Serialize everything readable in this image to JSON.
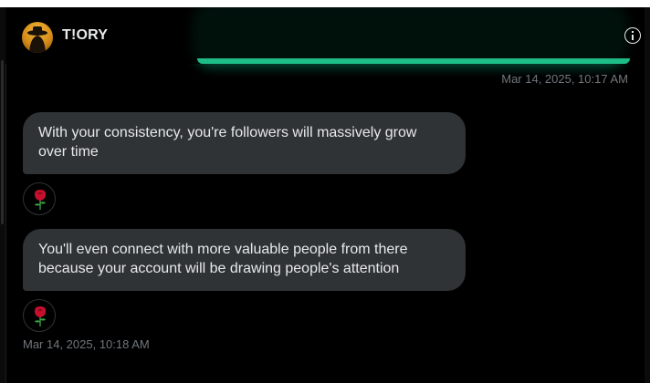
{
  "header": {
    "contact_name": "T!ORY",
    "avatar_icon": "silhouette-avatar-icon",
    "info_icon": "info-icon"
  },
  "messages": [
    {
      "direction": "sent",
      "text": "",
      "timestamp": "Mar 14, 2025, 10:17 AM"
    },
    {
      "direction": "received",
      "text": "With your consistency, you're followers will massively grow\nover time",
      "reaction": "rose"
    },
    {
      "direction": "received",
      "text": "You'll even connect with more valuable people from there\nbecause your account will be drawing people's attention",
      "reaction": "rose",
      "timestamp": "Mar 14, 2025, 10:18 AM"
    }
  ],
  "colors": {
    "background": "#000000",
    "received_bubble": "#2f3336",
    "sent_bubble": "#1ebd87",
    "text": "#e7e9ea",
    "muted_text": "#71767b"
  }
}
